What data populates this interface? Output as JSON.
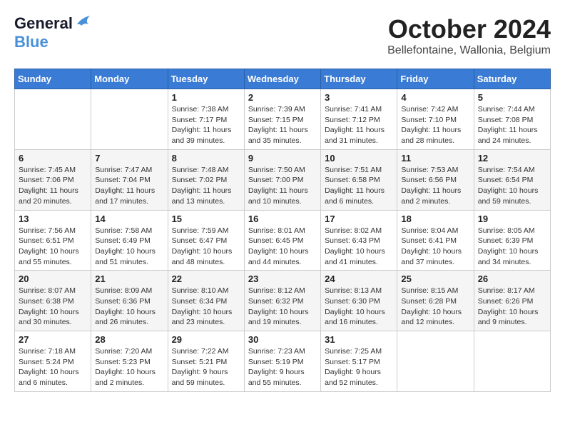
{
  "header": {
    "logo_general": "General",
    "logo_blue": "Blue",
    "month_title": "October 2024",
    "location": "Bellefontaine, Wallonia, Belgium"
  },
  "days_of_week": [
    "Sunday",
    "Monday",
    "Tuesday",
    "Wednesday",
    "Thursday",
    "Friday",
    "Saturday"
  ],
  "weeks": [
    [
      {
        "day": "",
        "info": ""
      },
      {
        "day": "",
        "info": ""
      },
      {
        "day": "1",
        "info": "Sunrise: 7:38 AM\nSunset: 7:17 PM\nDaylight: 11 hours and 39 minutes."
      },
      {
        "day": "2",
        "info": "Sunrise: 7:39 AM\nSunset: 7:15 PM\nDaylight: 11 hours and 35 minutes."
      },
      {
        "day": "3",
        "info": "Sunrise: 7:41 AM\nSunset: 7:12 PM\nDaylight: 11 hours and 31 minutes."
      },
      {
        "day": "4",
        "info": "Sunrise: 7:42 AM\nSunset: 7:10 PM\nDaylight: 11 hours and 28 minutes."
      },
      {
        "day": "5",
        "info": "Sunrise: 7:44 AM\nSunset: 7:08 PM\nDaylight: 11 hours and 24 minutes."
      }
    ],
    [
      {
        "day": "6",
        "info": "Sunrise: 7:45 AM\nSunset: 7:06 PM\nDaylight: 11 hours and 20 minutes."
      },
      {
        "day": "7",
        "info": "Sunrise: 7:47 AM\nSunset: 7:04 PM\nDaylight: 11 hours and 17 minutes."
      },
      {
        "day": "8",
        "info": "Sunrise: 7:48 AM\nSunset: 7:02 PM\nDaylight: 11 hours and 13 minutes."
      },
      {
        "day": "9",
        "info": "Sunrise: 7:50 AM\nSunset: 7:00 PM\nDaylight: 11 hours and 10 minutes."
      },
      {
        "day": "10",
        "info": "Sunrise: 7:51 AM\nSunset: 6:58 PM\nDaylight: 11 hours and 6 minutes."
      },
      {
        "day": "11",
        "info": "Sunrise: 7:53 AM\nSunset: 6:56 PM\nDaylight: 11 hours and 2 minutes."
      },
      {
        "day": "12",
        "info": "Sunrise: 7:54 AM\nSunset: 6:54 PM\nDaylight: 10 hours and 59 minutes."
      }
    ],
    [
      {
        "day": "13",
        "info": "Sunrise: 7:56 AM\nSunset: 6:51 PM\nDaylight: 10 hours and 55 minutes."
      },
      {
        "day": "14",
        "info": "Sunrise: 7:58 AM\nSunset: 6:49 PM\nDaylight: 10 hours and 51 minutes."
      },
      {
        "day": "15",
        "info": "Sunrise: 7:59 AM\nSunset: 6:47 PM\nDaylight: 10 hours and 48 minutes."
      },
      {
        "day": "16",
        "info": "Sunrise: 8:01 AM\nSunset: 6:45 PM\nDaylight: 10 hours and 44 minutes."
      },
      {
        "day": "17",
        "info": "Sunrise: 8:02 AM\nSunset: 6:43 PM\nDaylight: 10 hours and 41 minutes."
      },
      {
        "day": "18",
        "info": "Sunrise: 8:04 AM\nSunset: 6:41 PM\nDaylight: 10 hours and 37 minutes."
      },
      {
        "day": "19",
        "info": "Sunrise: 8:05 AM\nSunset: 6:39 PM\nDaylight: 10 hours and 34 minutes."
      }
    ],
    [
      {
        "day": "20",
        "info": "Sunrise: 8:07 AM\nSunset: 6:38 PM\nDaylight: 10 hours and 30 minutes."
      },
      {
        "day": "21",
        "info": "Sunrise: 8:09 AM\nSunset: 6:36 PM\nDaylight: 10 hours and 26 minutes."
      },
      {
        "day": "22",
        "info": "Sunrise: 8:10 AM\nSunset: 6:34 PM\nDaylight: 10 hours and 23 minutes."
      },
      {
        "day": "23",
        "info": "Sunrise: 8:12 AM\nSunset: 6:32 PM\nDaylight: 10 hours and 19 minutes."
      },
      {
        "day": "24",
        "info": "Sunrise: 8:13 AM\nSunset: 6:30 PM\nDaylight: 10 hours and 16 minutes."
      },
      {
        "day": "25",
        "info": "Sunrise: 8:15 AM\nSunset: 6:28 PM\nDaylight: 10 hours and 12 minutes."
      },
      {
        "day": "26",
        "info": "Sunrise: 8:17 AM\nSunset: 6:26 PM\nDaylight: 10 hours and 9 minutes."
      }
    ],
    [
      {
        "day": "27",
        "info": "Sunrise: 7:18 AM\nSunset: 5:24 PM\nDaylight: 10 hours and 6 minutes."
      },
      {
        "day": "28",
        "info": "Sunrise: 7:20 AM\nSunset: 5:23 PM\nDaylight: 10 hours and 2 minutes."
      },
      {
        "day": "29",
        "info": "Sunrise: 7:22 AM\nSunset: 5:21 PM\nDaylight: 9 hours and 59 minutes."
      },
      {
        "day": "30",
        "info": "Sunrise: 7:23 AM\nSunset: 5:19 PM\nDaylight: 9 hours and 55 minutes."
      },
      {
        "day": "31",
        "info": "Sunrise: 7:25 AM\nSunset: 5:17 PM\nDaylight: 9 hours and 52 minutes."
      },
      {
        "day": "",
        "info": ""
      },
      {
        "day": "",
        "info": ""
      }
    ]
  ]
}
